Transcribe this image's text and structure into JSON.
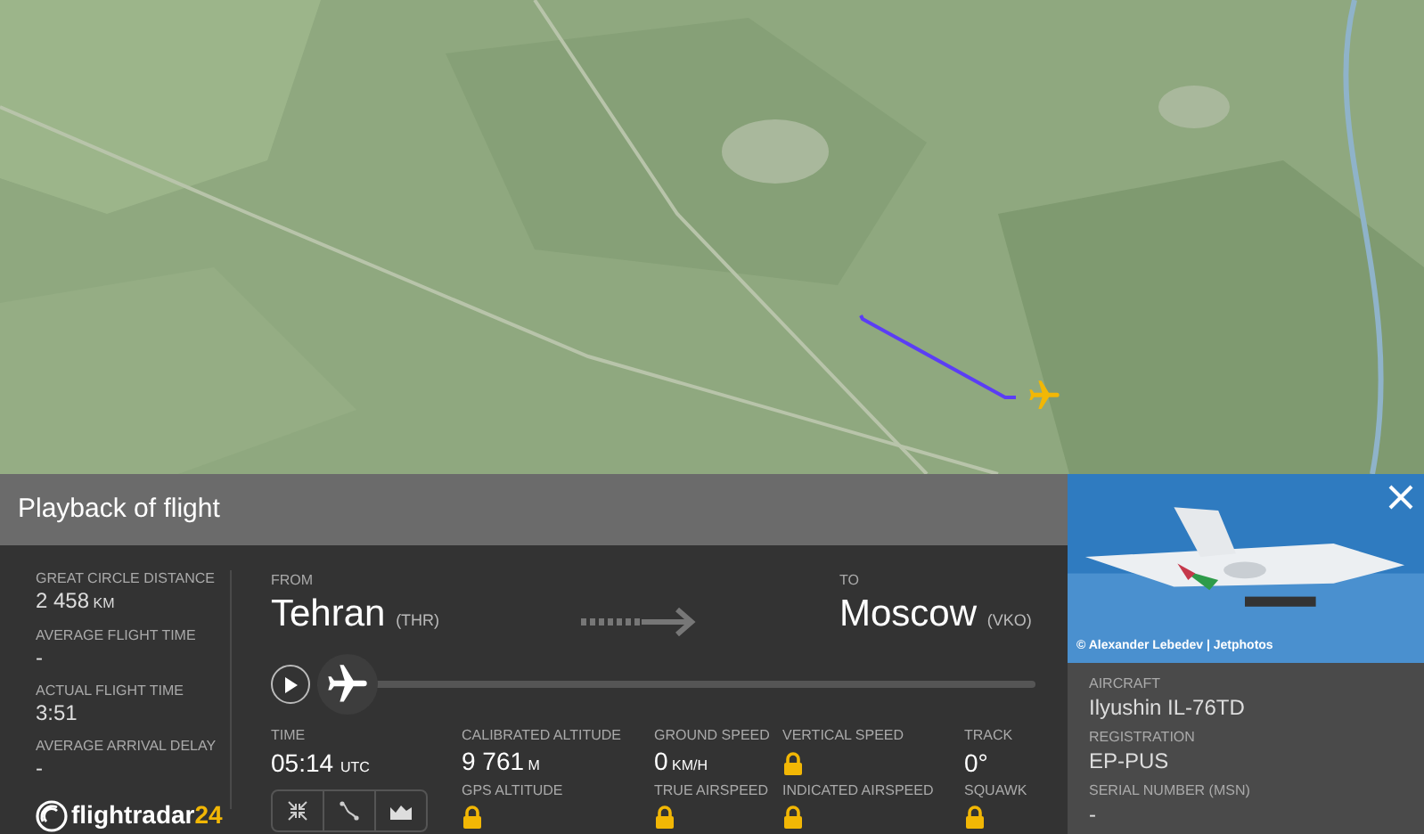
{
  "panel": {
    "title": "Playback of flight"
  },
  "summary": [
    {
      "label": "GREAT CIRCLE DISTANCE",
      "value": "2 458",
      "unit": "KM"
    },
    {
      "label": "AVERAGE FLIGHT TIME",
      "value": "-"
    },
    {
      "label": "ACTUAL FLIGHT TIME",
      "value": "3:51"
    },
    {
      "label": "AVERAGE ARRIVAL DELAY",
      "value": "-"
    }
  ],
  "logo": {
    "name": "flightradar",
    "suffix": "24"
  },
  "from": {
    "label": "FROM",
    "city": "Tehran",
    "code": "(THR)"
  },
  "to": {
    "label": "TO",
    "city": "Moscow",
    "code": "(VKO)"
  },
  "playback": {
    "level": 0
  },
  "time": {
    "label": "TIME",
    "value": "05:14",
    "unit": "UTC"
  },
  "stats": [
    {
      "label": "CALIBRATED ALTITUDE",
      "value": "9 761",
      "unit": "M",
      "label2": "GPS ALTITUDE",
      "locked2": true
    },
    {
      "label": "GROUND SPEED",
      "value": "0",
      "unit": "KM/H",
      "label2": "TRUE AIRSPEED",
      "locked2": true
    },
    {
      "label": "VERTICAL SPEED",
      "locked": true,
      "label2": "INDICATED AIRSPEED",
      "locked2": true
    },
    {
      "label": "TRACK",
      "value": "0°",
      "label2": "SQUAWK",
      "locked2": true
    }
  ],
  "photo": {
    "credit": "© Alexander Lebedev | Jetphotos"
  },
  "aircraft": [
    {
      "label": "AIRCRAFT",
      "value": "Ilyushin IL-76TD"
    },
    {
      "label": "REGISTRATION",
      "value": "EP-PUS"
    },
    {
      "label": "SERIAL NUMBER (MSN)",
      "value": "-"
    }
  ]
}
